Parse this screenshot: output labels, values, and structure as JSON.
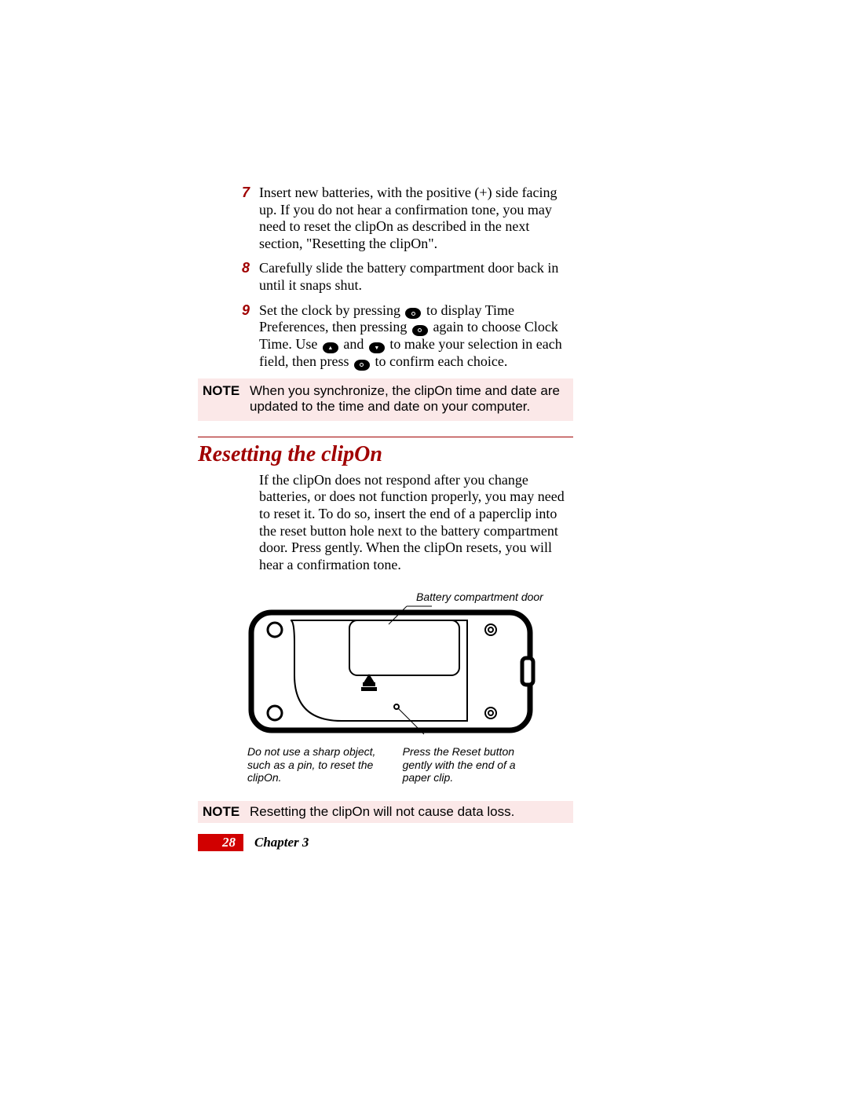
{
  "steps": {
    "s7": {
      "num": "7",
      "text": "Insert new batteries, with the positive (+) side facing up. If you do not hear a confirmation tone, you may need to reset the clipOn as described in the next section, \"Resetting the clipOn\"."
    },
    "s8": {
      "num": "8",
      "text": "Carefully slide the battery compartment door back in until it snaps shut."
    },
    "s9": {
      "num": "9",
      "frag1": "Set the clock by pressing ",
      "frag2": " to display Time Preferences, then pressing ",
      "frag3": " again to choose Clock Time. Use ",
      "frag4": " and ",
      "frag5": " to make your selection in each field, then press ",
      "frag6": " to confirm each choice."
    }
  },
  "note1": {
    "label": "NOTE",
    "text": "When you synchronize, the clipOn time and date are updated to the time and date on your computer."
  },
  "section_title": "Resetting the clipOn",
  "para": "If the clipOn does not respond after you change batteries, or does not function properly, you may need to reset it. To do so, insert the end of a paperclip into the reset button hole next to the battery compartment door. Press gently. When the clipOn resets, you will hear a confirmation tone.",
  "diagram": {
    "callout_top": "Battery compartment door",
    "callout_left": "Do not use a sharp object, such as a pin, to reset the clipOn.",
    "callout_right": "Press the Reset button gently with the end of a paper clip."
  },
  "note2": {
    "label": "NOTE",
    "text": "Resetting the clipOn will not cause data loss."
  },
  "footer": {
    "page": "28",
    "chapter": "Chapter 3"
  }
}
